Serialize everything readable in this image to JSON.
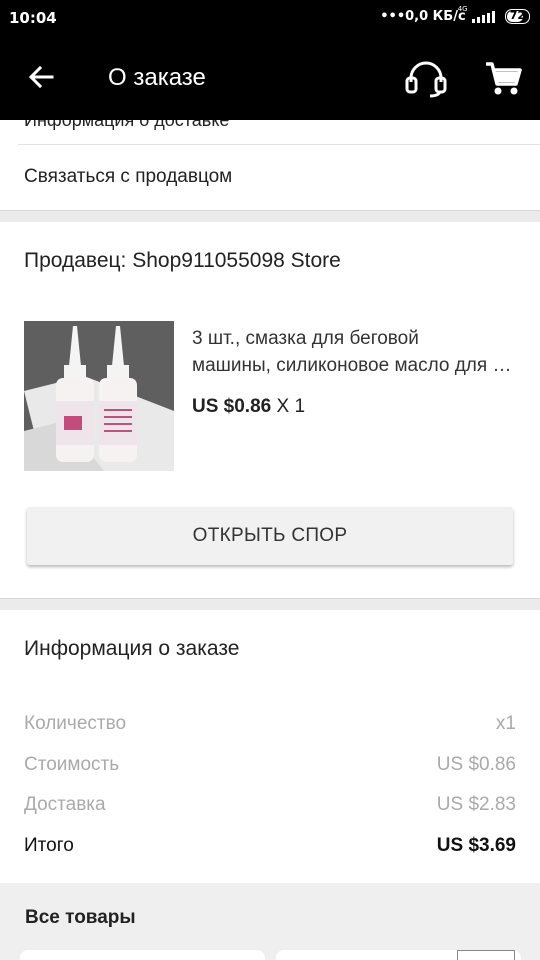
{
  "status_bar": {
    "time": "10:04",
    "network_speed": "•••0,0 КБ/c",
    "network_type": "4G",
    "battery": "72"
  },
  "app_bar": {
    "title": "О заказе",
    "icons": [
      "back-arrow-icon",
      "headset-icon",
      "cart-icon"
    ]
  },
  "contact_section": {
    "partial_text": "Информация о доставке",
    "contact_seller": "Связаться с продавцом"
  },
  "seller_section": {
    "seller_label": "Продавец: Shop911055098 Store",
    "product": {
      "title_line1": "3 шт., смазка для беговой",
      "title_line2": "машины, силиконовое масло для беговой",
      "price": "US $0.86",
      "quantity": "X 1"
    },
    "dispute_button": "ОТКРЫТЬ СПОР"
  },
  "order_info": {
    "title": "Информация о заказе",
    "rows": [
      {
        "label": "Количество",
        "value": "x1"
      },
      {
        "label": "Стоимость",
        "value": "US $0.86"
      },
      {
        "label": "Доставка",
        "value": "US $2.83"
      },
      {
        "label": "Итого",
        "value": "US $3.69"
      }
    ]
  },
  "all_items": {
    "title": "Все товары"
  },
  "colors": {
    "app_bar": "#000000",
    "background": "#ebebeb",
    "muted_text": "#aaaaaa"
  }
}
